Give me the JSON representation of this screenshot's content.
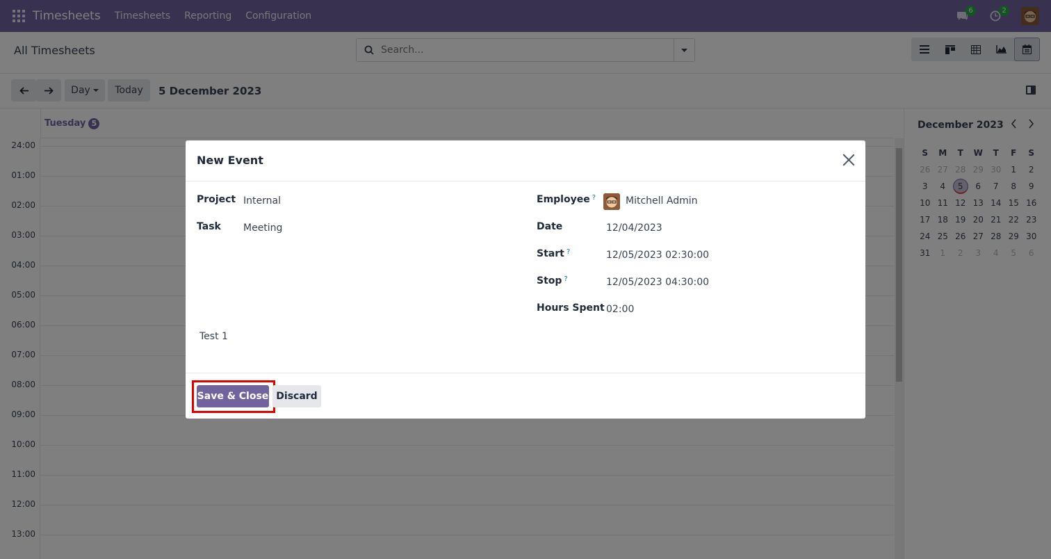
{
  "navbar": {
    "brand": "Timesheets",
    "menu": [
      "Timesheets",
      "Reporting",
      "Configuration"
    ],
    "messages_count": "6",
    "activities_count": "2",
    "bg_color": "#71639e"
  },
  "control_panel": {
    "breadcrumb": "All Timesheets",
    "search_placeholder": "Search...",
    "views": [
      "list-icon",
      "kanban-icon",
      "pivot-icon",
      "graph-icon",
      "calendar-icon"
    ],
    "active_view": "calendar-icon"
  },
  "toolbar": {
    "scale_label": "Day",
    "today_label": "Today",
    "current_date": "5 December 2023"
  },
  "calendar": {
    "day_name": "Tuesday",
    "day_number": "5",
    "hours": [
      "24:00",
      "01:00",
      "02:00",
      "03:00",
      "04:00",
      "05:00",
      "06:00",
      "07:00",
      "08:00",
      "09:00",
      "10:00",
      "11:00",
      "12:00",
      "13:00"
    ]
  },
  "mini_calendar": {
    "title": "December 2023",
    "weekdays": [
      "S",
      "M",
      "T",
      "W",
      "T",
      "F",
      "S"
    ],
    "weeks": [
      [
        "26",
        "27",
        "28",
        "29",
        "30",
        "1",
        "2"
      ],
      [
        "3",
        "4",
        "5",
        "6",
        "7",
        "8",
        "9"
      ],
      [
        "10",
        "11",
        "12",
        "13",
        "14",
        "15",
        "16"
      ],
      [
        "17",
        "18",
        "19",
        "20",
        "21",
        "22",
        "23"
      ],
      [
        "24",
        "25",
        "26",
        "27",
        "28",
        "29",
        "30"
      ],
      [
        "31",
        "1",
        "2",
        "3",
        "4",
        "5",
        "6"
      ]
    ],
    "today": "5"
  },
  "modal": {
    "title": "New Event",
    "project_label": "Project",
    "project_value": "Internal",
    "task_label": "Task",
    "task_value": "Meeting",
    "employee_label": "Employee",
    "employee_value": "Mitchell Admin",
    "date_label": "Date",
    "date_value": "12/04/2023",
    "start_label": "Start",
    "start_value": "12/05/2023 02:30:00",
    "stop_label": "Stop",
    "stop_value": "12/05/2023 04:30:00",
    "hours_label": "Hours Spent",
    "hours_value": "02:00",
    "description": "Test 1",
    "help_mark": "?",
    "save_label": "Save & Close",
    "discard_label": "Discard"
  }
}
